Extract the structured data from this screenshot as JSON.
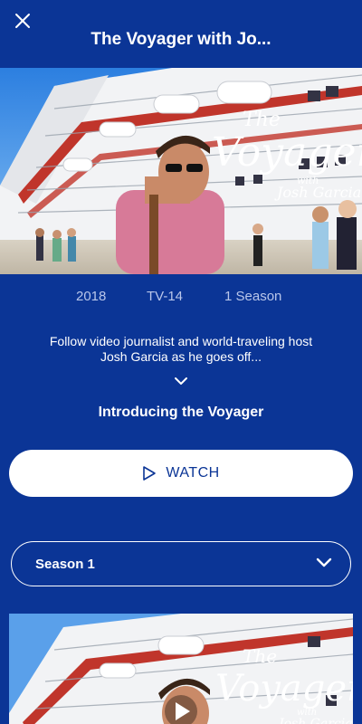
{
  "header": {
    "title": "The Voyager with Jo...",
    "close_icon": "close-icon"
  },
  "hero": {
    "logo_line1": "The",
    "logo_line2": "Voyager",
    "logo_line3": "with",
    "logo_line4": "Josh Garcia"
  },
  "meta": {
    "year": "2018",
    "rating": "TV-14",
    "seasons": "1 Season"
  },
  "description": "Follow video journalist and world-traveling host Josh Garcia as he goes off...",
  "expand_icon": "chevron-down-icon",
  "episode": {
    "title": "Introducing the Voyager"
  },
  "watch": {
    "label": "WATCH",
    "icon": "play-icon"
  },
  "season_selector": {
    "selected": "Season 1",
    "icon": "chevron-down-icon"
  },
  "colors": {
    "background": "#0b3596",
    "button_bg": "#ffffff",
    "button_text": "#0b3596",
    "meta_text": "#b9c6ea"
  }
}
